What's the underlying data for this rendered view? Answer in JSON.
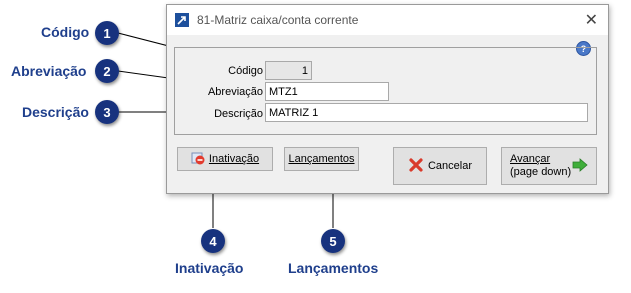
{
  "callouts": [
    {
      "number": "1",
      "label": "Código"
    },
    {
      "number": "2",
      "label": "Abreviação"
    },
    {
      "number": "3",
      "label": "Descrição"
    },
    {
      "number": "4",
      "label": "Inativação"
    },
    {
      "number": "5",
      "label": "Lançamentos"
    }
  ],
  "window": {
    "title": "81-Matriz caixa/conta corrente",
    "close_glyph": "✕"
  },
  "form": {
    "codigo_label": "Código",
    "codigo_value": "1",
    "abreviacao_label": "Abreviação",
    "abreviacao_value": "MTZ1",
    "descricao_label": "Descrição",
    "descricao_value": "MATRIZ 1"
  },
  "buttons": {
    "inativacao": "Inativação",
    "lancamentos": "Lançamentos",
    "cancelar": "Cancelar",
    "avancar_line1": "Avançar",
    "avancar_line2": "(page down)"
  },
  "icons": {
    "help": "help-icon",
    "app": "app-icon",
    "inativacao": "no-entry-icon",
    "cancelar": "red-x-icon",
    "avancar": "green-arrow-icon"
  },
  "colors": {
    "callout_bg": "#17327e",
    "callout_text": "#1f3f8c"
  }
}
